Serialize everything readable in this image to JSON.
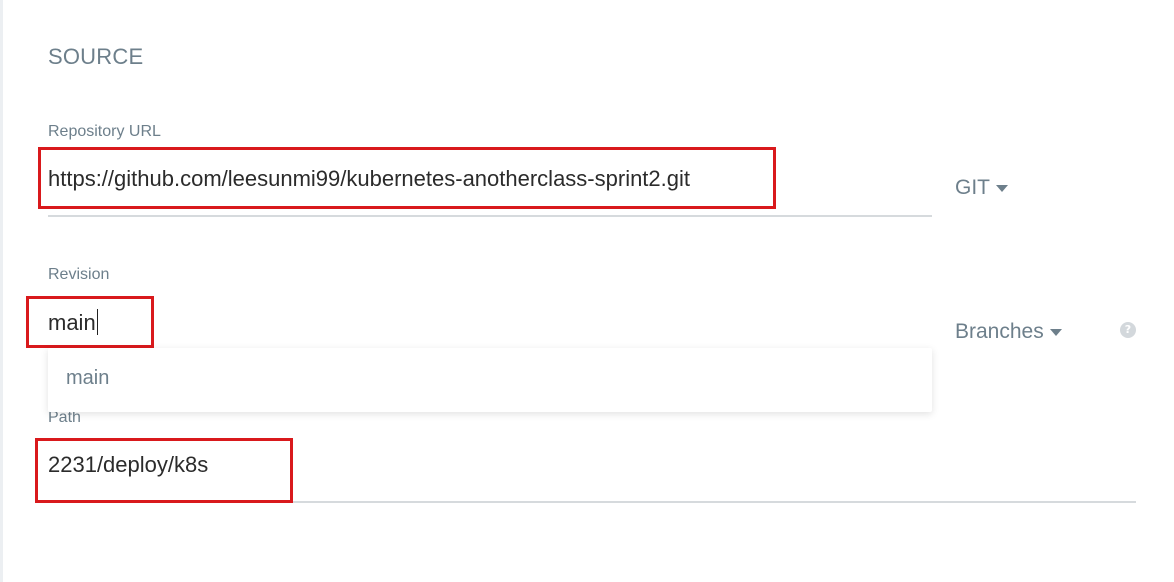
{
  "section": {
    "title": "SOURCE"
  },
  "repository": {
    "label": "Repository URL",
    "value": "https://github.com/leesunmi99/kubernetes-anotherclass-sprint2.git",
    "type_select": "GIT"
  },
  "revision": {
    "label": "Revision",
    "value": "main",
    "type_select": "Branches",
    "help_icon": "?",
    "suggestions": [
      "main"
    ]
  },
  "path": {
    "label": "Path",
    "value": "2231/deploy/k8s"
  },
  "colors": {
    "highlight": "#d9191c",
    "label": "#6d7f8b",
    "underline": "#d6dadd"
  }
}
